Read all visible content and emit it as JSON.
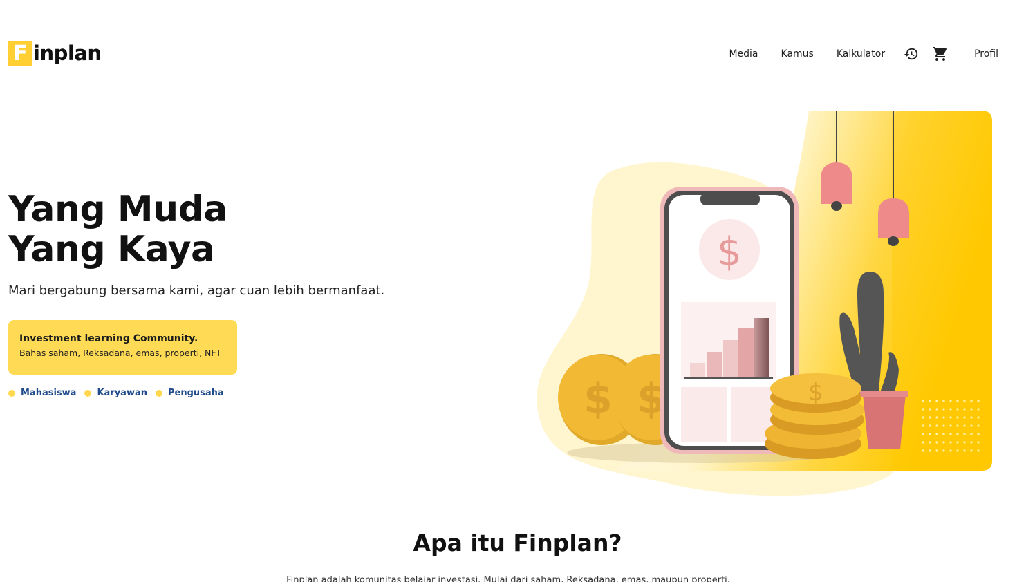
{
  "brand": {
    "mark": "F",
    "name": "inplan"
  },
  "nav": {
    "links": [
      "Media",
      "Kamus",
      "Kalkulator"
    ],
    "profile_label": "Profil"
  },
  "hero": {
    "title_line1": "Yang Muda",
    "title_line2": "Yang Kaya",
    "subtitle": "Mari bergabung bersama kami, agar cuan lebih bermanfaat."
  },
  "card": {
    "title": "Investment learning Community.",
    "description": "Bahas saham, Reksadana, emas, properti, NFT"
  },
  "audience": [
    "Mahasiswa",
    "Karyawan",
    "Pengusaha"
  ],
  "about": {
    "title": "Apa itu Finplan?",
    "text": "Finplan adalah komunitas belajar investasi. Mulai dari saham, Reksadana, emas, maupun properti."
  },
  "icons": {
    "history": "history-icon",
    "cart": "cart-icon"
  },
  "colors": {
    "accent": "#ffdb55",
    "logo": "#ffcf33",
    "link": "#1f4a8c"
  }
}
